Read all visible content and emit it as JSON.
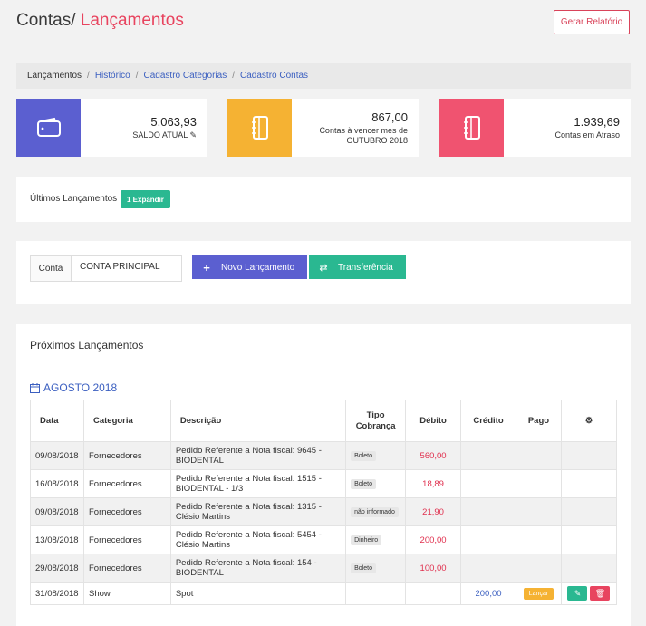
{
  "header": {
    "title_main": "Contas/",
    "title_accent": " Lançamentos",
    "report_button": "Gerar Relatório"
  },
  "breadcrumb": {
    "current": "Lançamentos",
    "links": [
      "Histórico",
      "Cadastro Categorias",
      "Cadastro Contas"
    ]
  },
  "stats": [
    {
      "value": "5.063,93",
      "label": "SALDO ATUAL",
      "icon": "wallet-icon",
      "color": "#5b5fd0"
    },
    {
      "value": "867,00",
      "label_line1": "Contas à vencer mes de",
      "label_line2": "OUTUBRO 2018",
      "icon": "notebook-icon",
      "color": "#f5b233"
    },
    {
      "value": "1.939,69",
      "label": "Contas em Atraso",
      "icon": "notebook-icon",
      "color": "#f05370"
    }
  ],
  "latest": {
    "label": "Últimos Lançamentos",
    "expand_button": "1 Expandir"
  },
  "account": {
    "addon": "Conta",
    "value": "CONTA PRINCIPAL",
    "new_button": "Novo Lançamento",
    "transfer_button": "Transferência"
  },
  "upcoming": {
    "title": "Próximos Lançamentos",
    "month": "AGOSTO 2018",
    "headers": {
      "date": "Data",
      "category": "Categoria",
      "description": "Descrição",
      "type1": "Tipo",
      "type2": "Cobrança",
      "debit": "Débito",
      "credit": "Crédito",
      "paid": "Pago"
    },
    "rows": [
      {
        "date": "09/08/2018",
        "category": "Fornecedores",
        "desc1": "Pedido Referente a Nota fiscal: 9645 -",
        "desc2": "BIODENTAL",
        "type": "Boleto",
        "debit": "560,00",
        "credit": ""
      },
      {
        "date": "16/08/2018",
        "category": "Fornecedores",
        "desc1": "Pedido Referente a Nota fiscal: 1515 -",
        "desc2": "BIODENTAL - 1/3",
        "type": "Boleto",
        "debit": "18,89",
        "credit": ""
      },
      {
        "date": "09/08/2018",
        "category": "Fornecedores",
        "desc1": "Pedido Referente a Nota fiscal: 1315 -",
        "desc2": "Clésio Martins",
        "type": "não informado",
        "debit": "21,90",
        "credit": ""
      },
      {
        "date": "13/08/2018",
        "category": "Fornecedores",
        "desc1": "Pedido Referente a Nota fiscal: 5454 -",
        "desc2": "Clésio Martins",
        "type": "Dinheiro",
        "debit": "200,00",
        "credit": ""
      },
      {
        "date": "29/08/2018",
        "category": "Fornecedores",
        "desc1": "Pedido Referente a Nota fiscal: 154 -",
        "desc2": "BIODENTAL",
        "type": "Boleto",
        "debit": "100,00",
        "credit": ""
      },
      {
        "date": "31/08/2018",
        "category": "Show",
        "desc1": "Spot",
        "desc2": "",
        "type": "",
        "debit": "",
        "credit": "200,00",
        "action": "Lançar"
      }
    ]
  }
}
